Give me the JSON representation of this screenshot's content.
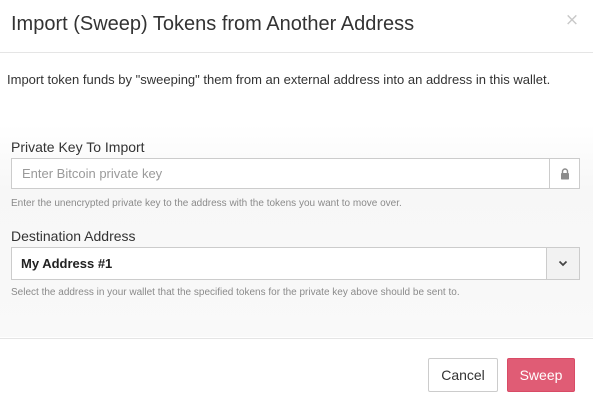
{
  "dialog": {
    "title": "Import (Sweep) Tokens from Another Address",
    "close_symbol": "×",
    "intro": "Import token funds by \"sweeping\" them from an external address into an address in this wallet."
  },
  "private_key": {
    "label": "Private Key To Import",
    "placeholder": "Enter Bitcoin private key",
    "value": "",
    "addon_icon": "lock-icon",
    "help": "Enter the unencrypted private key to the address with the tokens you want to move over."
  },
  "destination": {
    "label": "Destination Address",
    "selected": "My Address #1",
    "caret_icon": "chevron-down-icon",
    "help": "Select the address in your wallet that the specified tokens for the private key above should be sent to."
  },
  "footer": {
    "cancel_label": "Cancel",
    "sweep_label": "Sweep"
  },
  "colors": {
    "primary_button": "#e05c75",
    "muted_text": "#8a8a8a"
  }
}
